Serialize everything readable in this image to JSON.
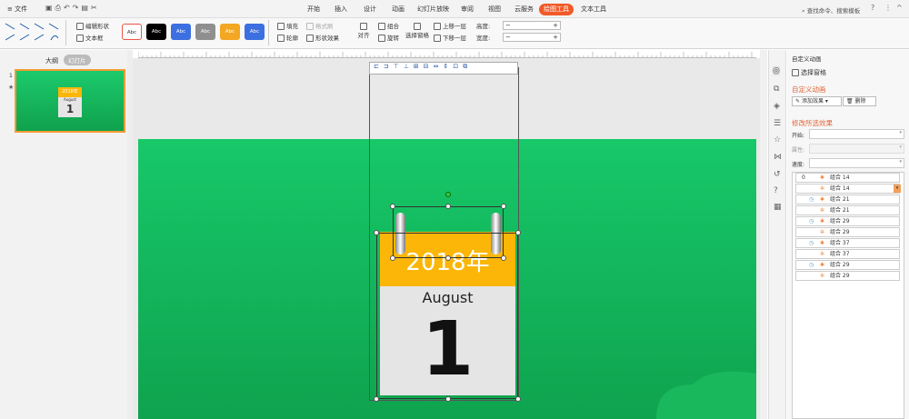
{
  "titlebar": {
    "file_menu": "文件",
    "tabs": [
      "开始",
      "插入",
      "设计",
      "动画",
      "幻灯片放映",
      "审阅",
      "视图",
      "云服务",
      "绘图工具",
      "文本工具"
    ],
    "active_tab": "绘图工具",
    "search": "查找命令、搜索模板"
  },
  "ribbon": {
    "edit_shape": "编辑形状",
    "text_box": "文本框",
    "style_label": "Abc",
    "fill": "填充",
    "outline": "轮廓",
    "format_brush": "格式刷",
    "shape_effect": "形状效果",
    "align": "对齐",
    "group": "组合",
    "rotate": "旋转",
    "select_pane": "选择窗格",
    "bring_forward": "上移一层",
    "send_backward": "下移一层",
    "height_label": "高度:",
    "width_label": "宽度:"
  },
  "left_pane": {
    "tab_outline": "大纲",
    "tab_slides": "幻灯片",
    "slide_number": "1",
    "thumb_year": "2018年",
    "thumb_month": "August",
    "thumb_day": "1"
  },
  "calendar": {
    "year": "2018年",
    "month": "August",
    "day": "1"
  },
  "anim_pane": {
    "header": "自定义动画",
    "select_pane": "选择窗格",
    "section_custom": "自定义动画",
    "add_effect": "添加效果",
    "delete": "删除",
    "section_modify": "修改所选效果",
    "start_label": "开始:",
    "property_label": "属性:",
    "speed_label": "速度:",
    "items": [
      {
        "num": "0",
        "name": "组合 14"
      },
      {
        "num": "",
        "name": "组合 14"
      },
      {
        "num": "",
        "name": "组合 21"
      },
      {
        "num": "",
        "name": "组合 21"
      },
      {
        "num": "",
        "name": "组合 29"
      },
      {
        "num": "",
        "name": "组合 29"
      },
      {
        "num": "",
        "name": "组合 37"
      },
      {
        "num": "",
        "name": "组合 37"
      },
      {
        "num": "",
        "name": "组合 29"
      },
      {
        "num": "",
        "name": "组合 29"
      }
    ]
  },
  "colors": {
    "accent": "#f15a29",
    "slide_green": "#17c869",
    "calendar_yellow": "#fbb608"
  }
}
